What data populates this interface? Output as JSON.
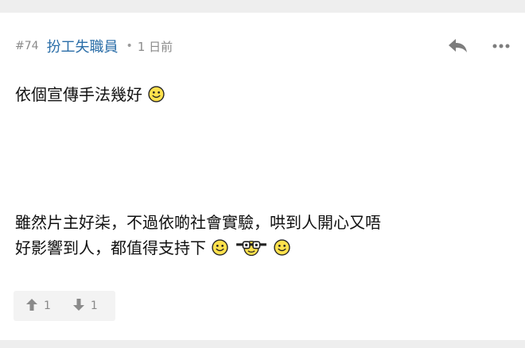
{
  "post": {
    "floor": "#74",
    "username": "扮工失職員",
    "separator": "•",
    "time": "1 日前",
    "paragraphs": [
      "依個宣傳手法幾好",
      "雖然片主好柒，不過依啲社會實驗，哄到人開心又唔",
      "好影響到人，都值得支持下"
    ]
  },
  "icons": {
    "reply": "reply-icon",
    "more": "more-icon",
    "smile": "smile-emoji-icon",
    "goggles": "goggles-emoji-icon",
    "upvote": "upvote-arrow-icon",
    "downvote": "downvote-arrow-icon"
  },
  "votes": {
    "up": "1",
    "down": "1"
  },
  "colors": {
    "username": "#2b6ea8",
    "background": "#eeeeee",
    "card": "#ffffff"
  }
}
